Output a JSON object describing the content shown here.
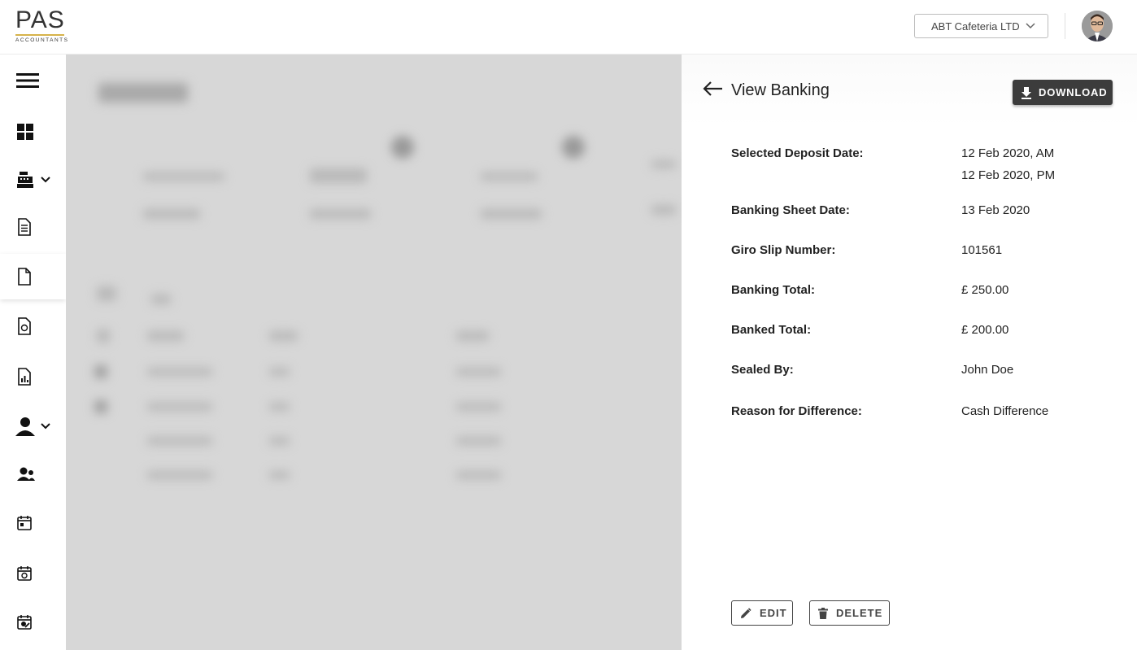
{
  "header": {
    "logo_text": "PAS",
    "logo_sub": "ACCOUNTANTS",
    "company_selected": "ABT Cafeteria LTD"
  },
  "sidebar": {
    "items": [
      {
        "icon": "menu-icon"
      },
      {
        "icon": "dashboard-icon"
      },
      {
        "icon": "cash-register-icon"
      },
      {
        "icon": "document-list-icon"
      },
      {
        "icon": "document-icon"
      },
      {
        "icon": "document-check-icon"
      },
      {
        "icon": "document-chart-icon"
      },
      {
        "icon": "user-icon"
      },
      {
        "icon": "users-icon"
      },
      {
        "icon": "calendar-icon"
      },
      {
        "icon": "calendar-check-icon"
      },
      {
        "icon": "calendar-edit-icon"
      }
    ]
  },
  "panel": {
    "title": "View Banking",
    "download_label": "DOWNLOAD",
    "fields": [
      {
        "label": "Selected Deposit Date:",
        "values": [
          "12 Feb 2020, AM",
          "12 Feb 2020, PM"
        ]
      },
      {
        "label": "Banking Sheet Date:",
        "values": [
          "13 Feb 2020"
        ]
      },
      {
        "label": "Giro Slip Number:",
        "values": [
          "101561"
        ]
      },
      {
        "label": "Banking Total:",
        "values": [
          "£ 250.00"
        ]
      },
      {
        "label": "Banked Total:",
        "values": [
          "£ 200.00"
        ]
      },
      {
        "label": "Sealed By:",
        "values": [
          "John Doe"
        ]
      },
      {
        "label": "Reason for Difference:",
        "values": [
          "Cash Difference"
        ]
      }
    ],
    "edit_label": "EDIT",
    "delete_label": "DELETE"
  }
}
